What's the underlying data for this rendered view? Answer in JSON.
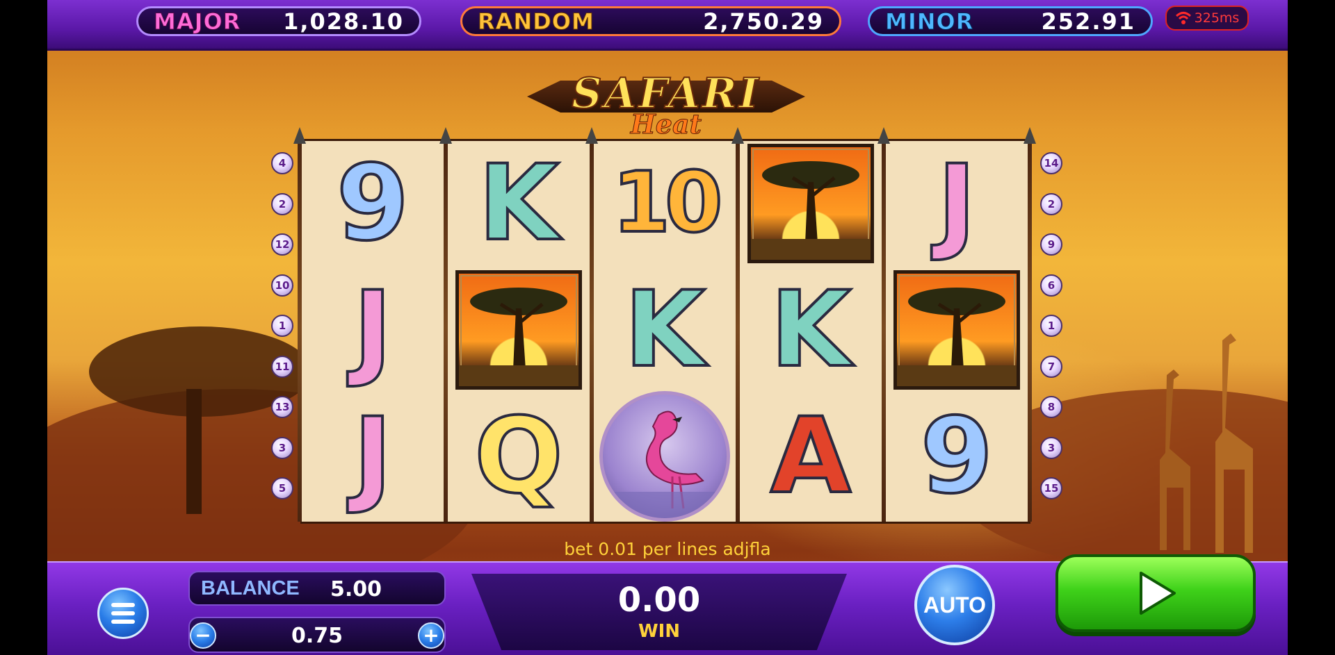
{
  "jackpots": [
    {
      "label": "MAJOR",
      "value": "1,028.10",
      "color": "#ff6bd8"
    },
    {
      "label": "RANDOM",
      "value": "2,750.29",
      "color": "#ffc23a"
    },
    {
      "label": "MINOR",
      "value": "252.91",
      "color": "#4fb7ff"
    }
  ],
  "ping": {
    "value": "325ms",
    "icon": "wifi-icon"
  },
  "logo": {
    "line1": "SAFARI",
    "line2": "Heat"
  },
  "reels": [
    [
      "9",
      "J",
      "J"
    ],
    [
      "K",
      "tree",
      "Q"
    ],
    [
      "10",
      "K",
      "flamingo"
    ],
    [
      "tree",
      "K",
      "A"
    ],
    [
      "J",
      "tree",
      "9"
    ]
  ],
  "symbol_colors": {
    "9": "#9fc8ff",
    "K": "#7fd2c0",
    "10": "#ffb53a",
    "J": "#f49ad6",
    "Q": "#ffe36a",
    "A": "#e2432a"
  },
  "paylines_left": [
    "4",
    "2",
    "12",
    "10",
    "1",
    "11",
    "13",
    "3",
    "5"
  ],
  "paylines_right": [
    "14",
    "2",
    "9",
    "6",
    "1",
    "7",
    "8",
    "3",
    "15"
  ],
  "hint": "bet 0.01 per lines adjfla",
  "balance": {
    "label": "BALANCE",
    "value": "5.00"
  },
  "bet": {
    "value": "0.75",
    "minus": "−",
    "plus": "+"
  },
  "win": {
    "value": "0.00",
    "label": "WIN"
  },
  "auto": {
    "label": "AUTO"
  }
}
